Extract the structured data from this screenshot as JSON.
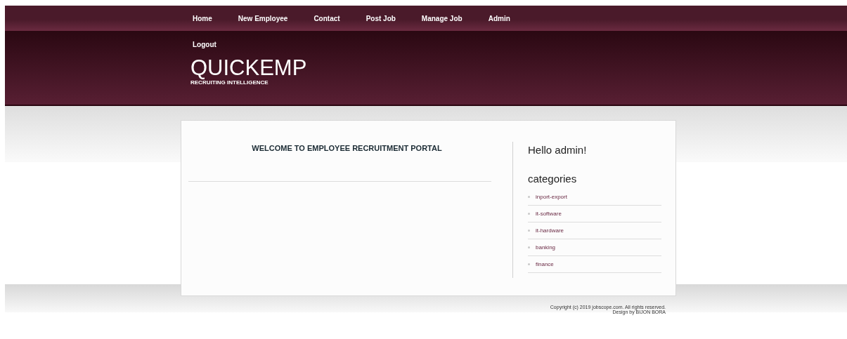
{
  "nav": [
    {
      "label": "Home"
    },
    {
      "label": "New Employee"
    },
    {
      "label": "Contact"
    },
    {
      "label": "Post Job"
    },
    {
      "label": "Manage Job"
    },
    {
      "label": "Admin"
    }
  ],
  "header": {
    "logout": "Logout",
    "logo": "QUICKEMP",
    "tagline": "RECRUITING INTELLIGENCE"
  },
  "main": {
    "heading": "WELCOME TO EMPLOYEE RECRUITMENT PORTAL"
  },
  "sidebar": {
    "greeting": "Hello admin!",
    "categories_title": "categories",
    "categories": [
      "inport-export",
      "it-software",
      "it-hardware",
      "banking",
      "finance"
    ]
  },
  "footer": {
    "copyright": "Copyright (c) 2019 jobscope.com. All rights reserved.",
    "credit": "Design by BIJON BORA"
  }
}
